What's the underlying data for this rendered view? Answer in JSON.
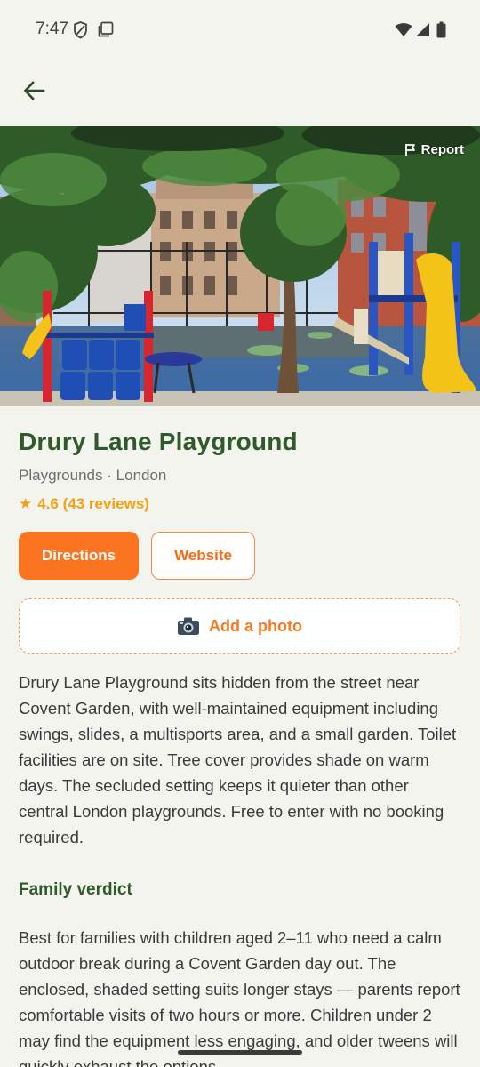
{
  "status_bar": {
    "time": "7:47"
  },
  "hero": {
    "report_label": "Report"
  },
  "place": {
    "title": "Drury Lane Playground",
    "category": "Playgrounds",
    "separator": "·",
    "city": "London",
    "rating_star": "★",
    "rating_text": "4.6 (43 reviews)"
  },
  "actions": {
    "directions_label": "Directions",
    "website_label": "Website",
    "add_photo_label": "Add a photo"
  },
  "description": "Drury Lane Playground sits hidden from the street near Covent Garden, with well-maintained equipment including swings, slides, a multisports area, and a small garden. Toilet facilities are on site. Tree cover provides shade on warm days. The secluded setting keeps it quieter than other central London playgrounds. Free to enter with no booking required.",
  "family_verdict": {
    "heading": "Family verdict",
    "text": "Best for families with children aged 2–11 who need a calm outdoor break during a Covent Garden day out. The enclosed, shaded setting suits longer stays — parents report comfortable visits of two hours or more. Children under 2 may find the equipment less engaging, and older tweens will quickly exhaust the options."
  },
  "colors": {
    "title_green": "#2e5a2c",
    "primary_orange": "#fb7420",
    "rating_amber": "#f2a116",
    "background": "#f4f4ef"
  },
  "icons": {
    "back": "arrow-left-icon",
    "report": "flag-icon",
    "camera": "camera-icon",
    "star": "star-icon"
  }
}
